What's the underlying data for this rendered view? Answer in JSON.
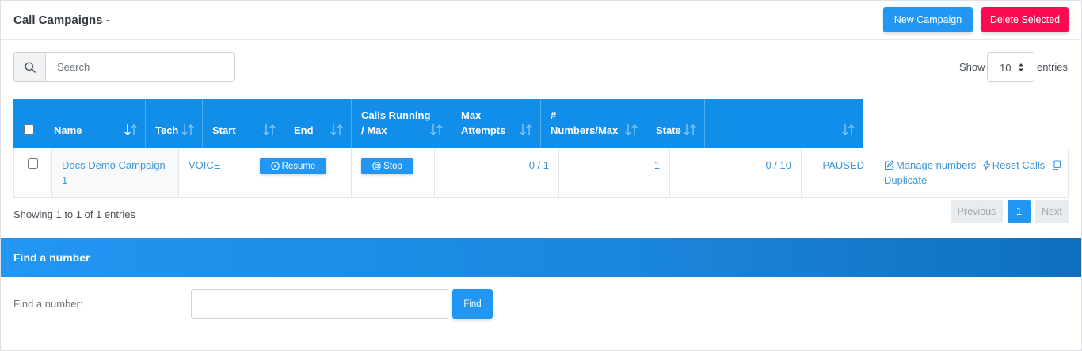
{
  "header": {
    "title": "Call Campaigns -",
    "new_campaign": "New Campaign",
    "delete_selected": "Delete Selected"
  },
  "search": {
    "placeholder": "Search",
    "icon": "search-icon"
  },
  "length": {
    "show": "Show",
    "value": "10",
    "entries": "entries"
  },
  "table": {
    "columns": [
      "Name",
      "Tech",
      "Start",
      "End",
      "Calls Running / Max",
      "Max Attempts",
      "# Numbers/Max",
      "State",
      ""
    ],
    "rows": [
      {
        "name": "Docs Demo Campaign 1",
        "tech": "VOICE",
        "start_btn": "Resume",
        "end_btn": "Stop",
        "calls_running": "0 / 1",
        "max_attempts": "1",
        "numbers_max": "0 / 10",
        "state": "PAUSED",
        "actions": {
          "manage": "Manage numbers",
          "reset": "Reset Calls",
          "duplicate": "Duplicate"
        }
      }
    ]
  },
  "footer": {
    "info": "Showing 1 to 1 of 1 entries",
    "previous": "Previous",
    "page": "1",
    "next": "Next"
  },
  "find": {
    "title": "Find a number",
    "label": "Find a number:",
    "button": "Find"
  },
  "colors": {
    "primary": "#2196f3",
    "danger": "#fa0a50",
    "table_header": "#108ee9",
    "link": "#3e95d8"
  }
}
